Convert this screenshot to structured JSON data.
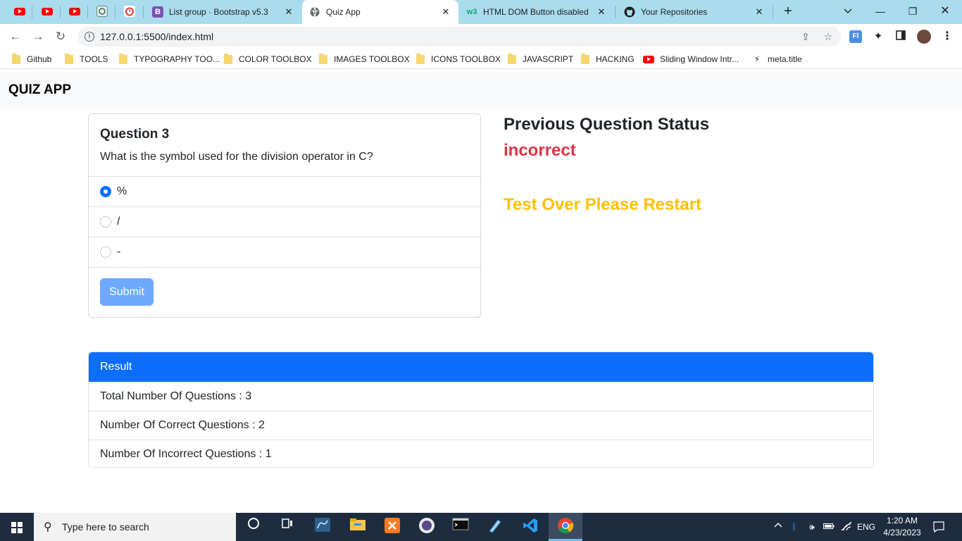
{
  "browser": {
    "tabs": [
      {
        "label": "List group · Bootstrap v5.3",
        "favicon": "bootstrap-icon",
        "favicon_text": "B"
      },
      {
        "label": "Quiz App",
        "favicon": "globe-icon",
        "active": true
      },
      {
        "label": "HTML DOM Button disabled P",
        "favicon": "w3schools-icon",
        "favicon_text": "w3"
      },
      {
        "label": "Your Repositories",
        "favicon": "github-icon"
      }
    ],
    "address": "127.0.0.1:5500/index.html",
    "bookmarks": [
      {
        "label": "Github",
        "icon": "folder-icon"
      },
      {
        "label": "TOOLS",
        "icon": "folder-icon"
      },
      {
        "label": "TYPOGRAPHY TOO...",
        "icon": "folder-icon"
      },
      {
        "label": "COLOR TOOLBOX",
        "icon": "folder-icon"
      },
      {
        "label": "IMAGES TOOLBOX",
        "icon": "folder-icon"
      },
      {
        "label": "ICONS TOOLBOX",
        "icon": "folder-icon"
      },
      {
        "label": "JAVASCRIPT",
        "icon": "folder-icon"
      },
      {
        "label": "HACKING",
        "icon": "folder-icon"
      },
      {
        "label": "Sliding Window Intr...",
        "icon": "youtube-icon"
      },
      {
        "label": "meta.title",
        "icon": "code-icon"
      }
    ]
  },
  "app": {
    "brand": "QUIZ APP",
    "question": {
      "title": "Question 3",
      "text": "What is the symbol used for the division operator in C?",
      "options": [
        {
          "label": "%",
          "checked": true
        },
        {
          "label": "/",
          "checked": false
        },
        {
          "label": "-",
          "checked": false
        }
      ],
      "submit_label": "Submit"
    },
    "status": {
      "heading": "Previous Question Status",
      "value": "incorrect",
      "message": "Test Over Please Restart"
    },
    "result": {
      "heading": "Result",
      "items": [
        "Total Number Of Questions : 3",
        "Number Of Correct Questions : 2",
        "Number Of Incorrect Questions : 1"
      ]
    }
  },
  "taskbar": {
    "search_placeholder": "Type here to search",
    "language": "ENG",
    "time": "1:20 AM",
    "date": "4/23/2023"
  },
  "colors": {
    "primary": "#0d6efd",
    "danger": "#dc3545",
    "warning": "#ffc107",
    "submit_disabled": "#6ea8fe"
  }
}
